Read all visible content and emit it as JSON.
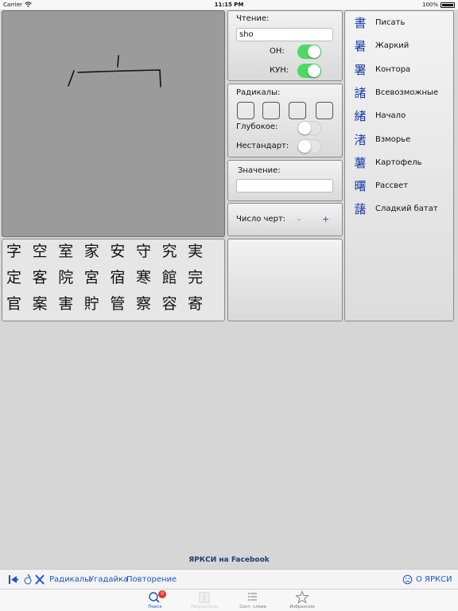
{
  "status_bar": {
    "carrier": "Carrier",
    "time": "11:15 PM",
    "battery": "100%"
  },
  "candidates": [
    "字",
    "空",
    "室",
    "家",
    "安",
    "守",
    "究",
    "実",
    "定",
    "客",
    "院",
    "宮",
    "宿",
    "寒",
    "館",
    "完",
    "官",
    "案",
    "害",
    "貯",
    "管",
    "察",
    "容",
    "寄"
  ],
  "reading": {
    "label": "Чтение:",
    "value": "sho",
    "on_label": "ОН:",
    "on_enabled": true,
    "kun_label": "КУН:",
    "kun_enabled": true
  },
  "radicals": {
    "label": "Радикалы:",
    "deep_label": "Глубокое:",
    "deep_enabled": false,
    "nonstandard_label": "Нестандарт:",
    "nonstandard_enabled": false
  },
  "meaning": {
    "label": "Значение:",
    "value": ""
  },
  "strokes": {
    "label": "Число черт:",
    "minus": "-",
    "plus": "+"
  },
  "results": [
    {
      "kanji": "書",
      "meaning": "Писать"
    },
    {
      "kanji": "暑",
      "meaning": "Жаркий"
    },
    {
      "kanji": "署",
      "meaning": "Контора"
    },
    {
      "kanji": "諸",
      "meaning": "Всевозможные"
    },
    {
      "kanji": "緒",
      "meaning": "Начало"
    },
    {
      "kanji": "渚",
      "meaning": "Взморье"
    },
    {
      "kanji": "薯",
      "meaning": "Картофель"
    },
    {
      "kanji": "曙",
      "meaning": "Рассвет"
    },
    {
      "kanji": "藷",
      "meaning": "Сладкий батат"
    }
  ],
  "facebook_link": "ЯРКСИ на Facebook",
  "toolbar": {
    "radicals": "Радикалы",
    "guess": "Угадайка",
    "repeat": "Повторение",
    "about": "О ЯРКСИ"
  },
  "tabs": [
    {
      "label": "Поиск",
      "icon": "search-icon",
      "badge": "0"
    },
    {
      "label": "Результаты",
      "icon": "results-icon"
    },
    {
      "label": "Сост. слова",
      "icon": "list-icon"
    },
    {
      "label": "Избранное",
      "icon": "star-icon"
    }
  ],
  "colors": {
    "accent": "#1a55c8",
    "toggle_on": "#4cd964",
    "kanji": "#1a3aa8",
    "badge": "#e8312b"
  }
}
